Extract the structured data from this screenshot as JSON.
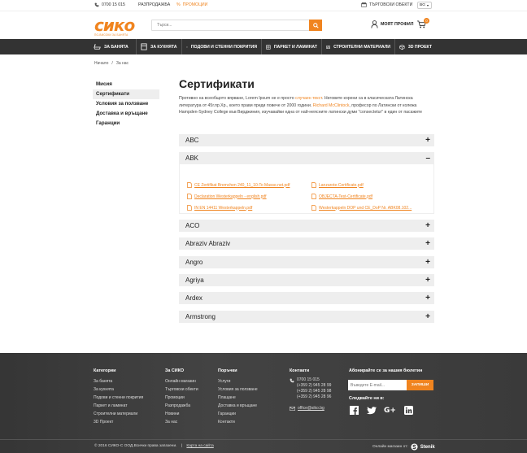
{
  "topbar": {
    "phone": "0700 15 015",
    "sale": "РАЗПРОДАЖБА",
    "promo": "ПРОМОЦИИ",
    "stores": "ТЪРГОВСКИ ОБЕКТИ",
    "lang": "BG"
  },
  "header": {
    "logo": "сико",
    "logo_tagline": "ПО-ВИСОКИ ЗА БАНЯТА",
    "search_placeholder": "Търси...",
    "profile": "МОЯТ ПРОФИЛ",
    "cart_count": "0"
  },
  "nav": [
    {
      "label": "ЗА БАНЯТА",
      "icon": "bath-icon"
    },
    {
      "label": "ЗА КУХНЯТА",
      "icon": "kitchen-icon"
    },
    {
      "label": "ПОДОВИ И СТЕННИ ПОКРИТИЯ",
      "icon": "tiles-icon"
    },
    {
      "label": "ПАРКЕТ И ЛАМИНАТ",
      "icon": "parquet-icon"
    },
    {
      "label": "СТРОИТЕЛНИ МАТЕРИАЛИ",
      "icon": "bricks-icon"
    },
    {
      "label": "3D ПРОЕКТ",
      "icon": "cube-icon"
    }
  ],
  "breadcrumb": [
    "Начало",
    "За нас"
  ],
  "sidebar": [
    "Мисия",
    "Сертификати",
    "Условия за ползване",
    "Доставка и връщане",
    "Гаранции"
  ],
  "page": {
    "title": "Сертификати",
    "intro_1": "Противно на всеобщото вярване, Lorem Ipsum не е просто ",
    "intro_link1": "случаен текст",
    "intro_2": ". Неговите корени са в класическата Латинска литература от 45г.пр.Хр., което прави преди повече от 2000 години. ",
    "intro_link2": "Richard McClintock",
    "intro_3": ", професор по Латински от колежа Hampden-Sydney College във Вирджиния, изучавайки една от най-неясните латински думи \"consectetur\" в един от пасажите"
  },
  "accordion": [
    {
      "label": "ABC",
      "open": false
    },
    {
      "label": "ABK",
      "open": true,
      "files": [
        "CE Zertifikat Bremchen 240_11_10-To Masse.net.pdf",
        "Lanzarote-Certificate.pdf",
        "Declaration Westerkappeln - english.pdf",
        "OBJECTA-Test-Certificate.pdf",
        "IN EN 14411 Westerkappeln.pdf",
        "Westerkappeln DOP und CE_DoP Nr. ABK08.102..."
      ]
    },
    {
      "label": "ACO",
      "open": false
    },
    {
      "label": "Abraziv Abraziv",
      "open": false
    },
    {
      "label": "Angro",
      "open": false
    },
    {
      "label": "Agriya",
      "open": false
    },
    {
      "label": "Ardex",
      "open": false
    },
    {
      "label": "Armstrong",
      "open": false
    }
  ],
  "footer": {
    "cols": [
      {
        "title": "Категории",
        "links": [
          "За банята",
          "За кухнята",
          "Подови и стенни покрития",
          "Паркет и ламинат",
          "Строителни материали",
          "3D Проект"
        ]
      },
      {
        "title": "За СИКО",
        "links": [
          "Онлайн магазин",
          "Търговски обекти",
          "Промоции",
          "Разпродажба",
          "Новини",
          "За нас"
        ]
      },
      {
        "title": "Поръчки",
        "links": [
          "Услуги",
          "Условия за ползване",
          "Плащане",
          "Доставка и връщане",
          "Гаранции",
          "Контакти"
        ]
      },
      {
        "title": "Контакти",
        "links": [
          "0700 15 015",
          "(+359 2) 945 28 99",
          "(+359 2) 945 28 98",
          "(+359 2) 945 28 96",
          "",
          "office@siko.bg"
        ]
      }
    ],
    "newsletter_title": "Абонирайте се за нашия бюлетин",
    "newsletter_placeholder": "Въведете E-mail...",
    "newsletter_button": "ЗАПИШИ",
    "follow": "Следвайте ни в:",
    "copyright": "© 2016 СИКО-С ООД.Всички права запазени.",
    "sitemap": "Карта на сайта",
    "dev": "Онлайн магазин от:",
    "dev_brand": "Stenik"
  }
}
